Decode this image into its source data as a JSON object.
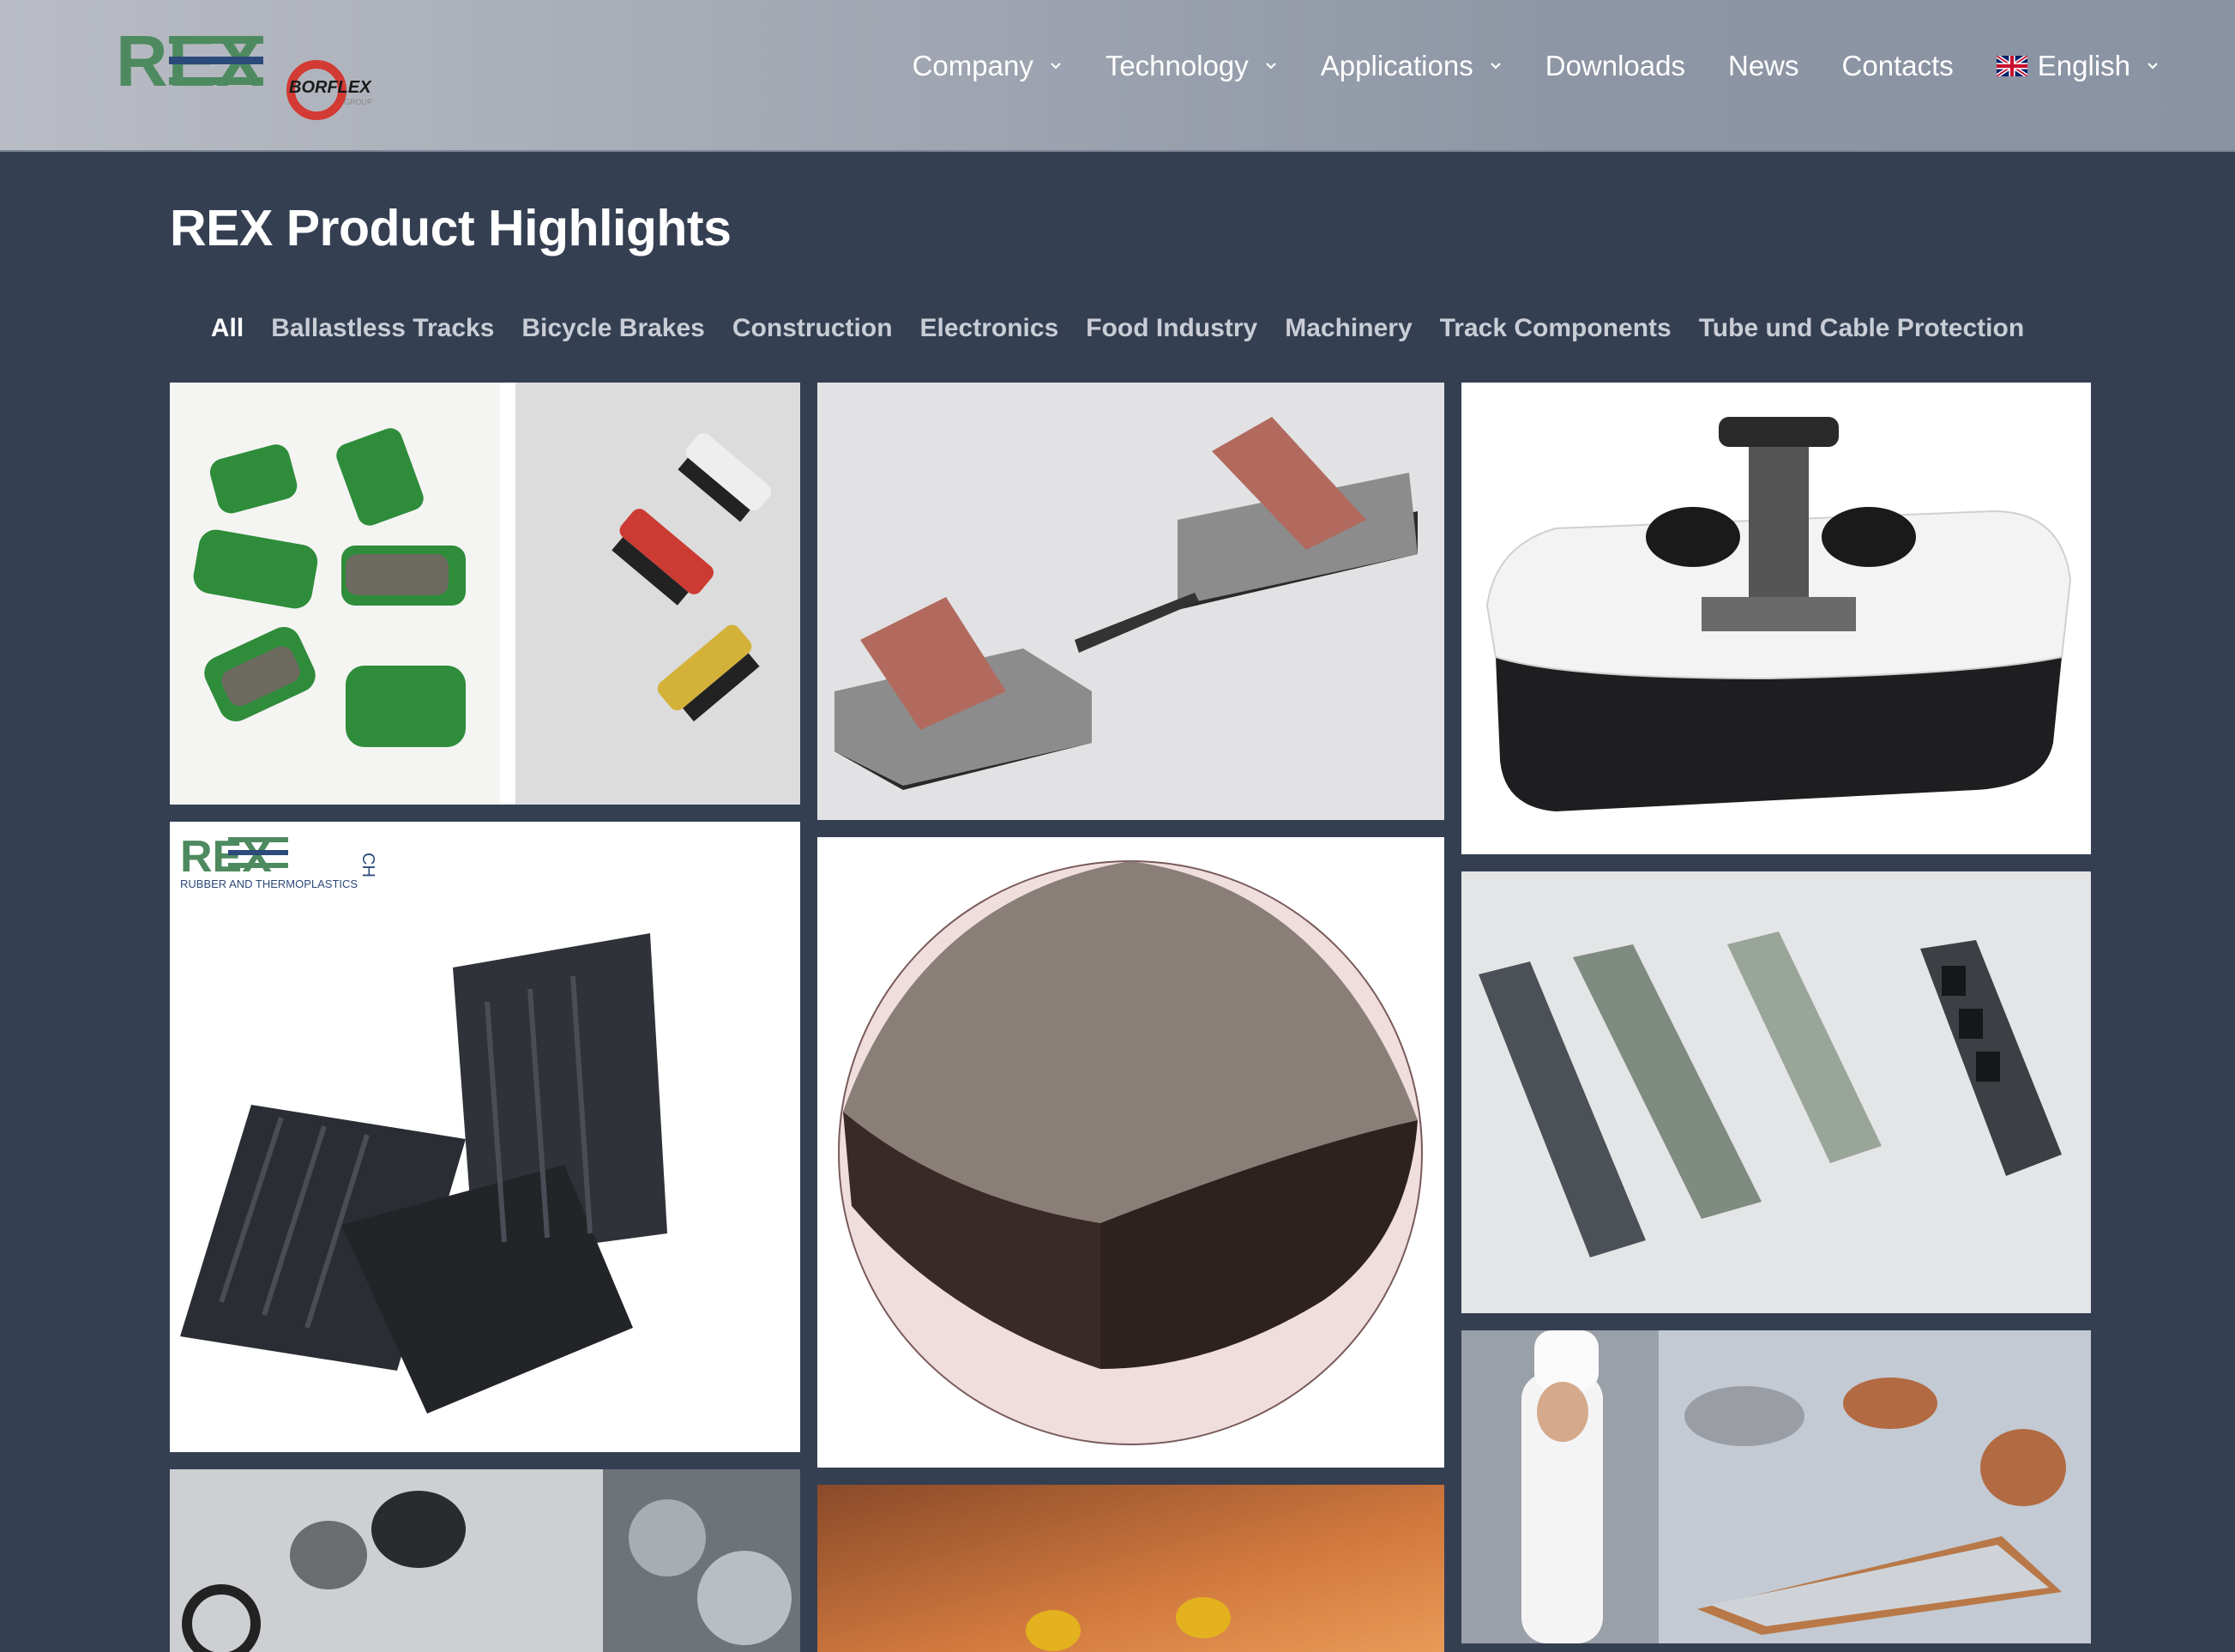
{
  "header": {
    "logo": {
      "main_text": "REX",
      "sub_text": "BORFLEX",
      "sub_group": "GROUP"
    },
    "nav": [
      {
        "label": "Company",
        "dropdown": true
      },
      {
        "label": "Technology",
        "dropdown": true
      },
      {
        "label": "Applications",
        "dropdown": true
      },
      {
        "label": "Downloads",
        "dropdown": false
      },
      {
        "label": "News",
        "dropdown": false
      },
      {
        "label": "Contacts",
        "dropdown": false
      }
    ],
    "language": {
      "label": "English",
      "icon": "uk-flag-icon"
    }
  },
  "main": {
    "title": "REX Product Highlights",
    "filters": [
      {
        "label": "All",
        "active": true
      },
      {
        "label": "Ballastless Tracks",
        "active": false
      },
      {
        "label": "Bicycle Brakes",
        "active": false
      },
      {
        "label": "Construction",
        "active": false
      },
      {
        "label": "Electronics",
        "active": false
      },
      {
        "label": "Food Industry",
        "active": false
      },
      {
        "label": "Machinery",
        "active": false
      },
      {
        "label": "Track Components",
        "active": false
      },
      {
        "label": "Tube und Cable Protection",
        "active": false
      }
    ],
    "tile_logo": {
      "main_text": "REX",
      "side_text": "CH",
      "caption": "RUBBER AND THERMOPLASTICS"
    }
  },
  "colors": {
    "background": "#353f52",
    "header_gradient_start": "#b9bcc4",
    "header_gradient_end": "#8a93a3",
    "logo_green": "#4e8a5f",
    "logo_blue": "#2c4a7a",
    "logo_red": "#d23a33"
  }
}
